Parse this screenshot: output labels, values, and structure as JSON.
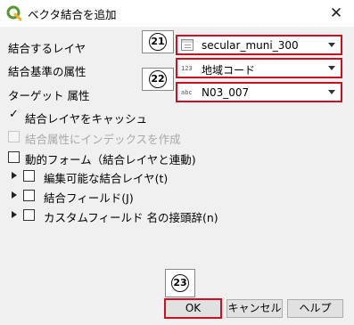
{
  "window": {
    "title": "ベクタ結合を追加",
    "logo_icon": "qgis-logo-icon",
    "close_icon": "close-icon",
    "close_symbol": "✕"
  },
  "fields": {
    "join_layer": {
      "label": "結合するレイヤ",
      "value": "secular_muni_300",
      "icon": "vector-table-icon"
    },
    "join_field": {
      "label": "結合基準の属性",
      "value": "地域コード",
      "type_icon": "123"
    },
    "target_field": {
      "label": "ターゲット 属性",
      "value": "N03_007",
      "type_icon": "abc"
    }
  },
  "options": {
    "cache_layer": {
      "label": "結合レイヤをキャッシュ",
      "checked": true,
      "check_symbol": "✓"
    },
    "create_index": {
      "label": "結合属性にインデックスを作成",
      "checked": false,
      "enabled": false
    },
    "dynamic_form": {
      "label": "動的フォーム（結合レイヤと連動)",
      "checked": false
    },
    "editable_layer": {
      "label": "編集可能な結合レイヤ(t)",
      "checked": false
    },
    "joined_fields": {
      "label": "結合フィールド(J)",
      "checked": false
    },
    "custom_prefix": {
      "label": "カスタムフィールド 名の接頭辞(n)",
      "checked": false
    }
  },
  "markers": {
    "m21": "21",
    "m22": "22",
    "m23": "23"
  },
  "buttons": {
    "ok": "OK",
    "cancel": "キャンセル",
    "help": "ヘルプ"
  },
  "colors": {
    "annotation_red": "#cc1020",
    "qgis_green": "#589632",
    "qgis_yellow": "#f0b429"
  }
}
